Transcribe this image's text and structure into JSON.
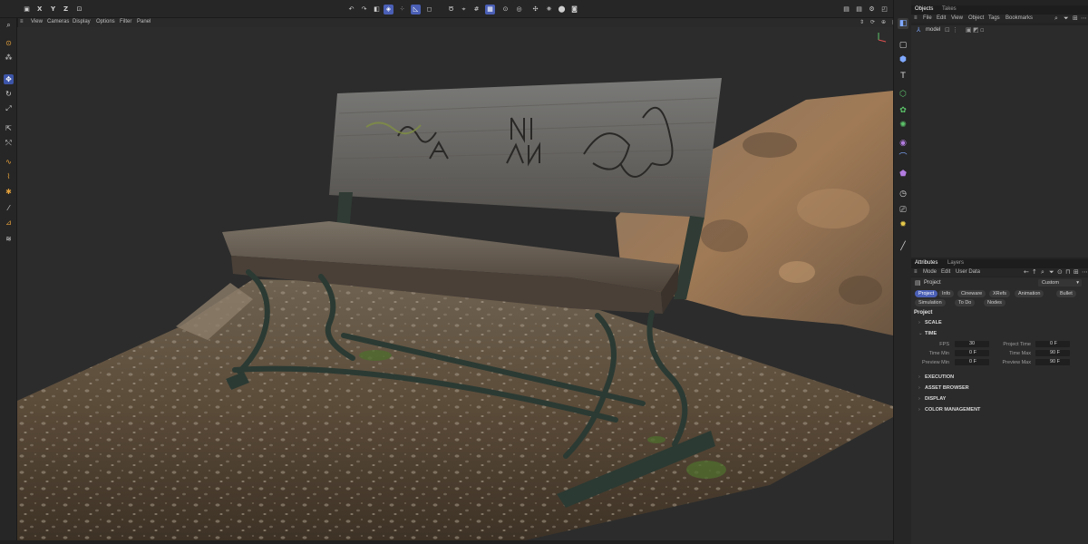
{
  "top_toolbar": {
    "axes": [
      "X",
      "Y",
      "Z"
    ]
  },
  "viewport_menu": [
    "View",
    "Cameras",
    "Display",
    "Options",
    "Filter",
    "Panel"
  ],
  "objects_panel": {
    "tabs": [
      "Objects",
      "Takes"
    ],
    "menu": [
      "File",
      "Edit",
      "View",
      "Object",
      "Tags",
      "Bookmarks"
    ],
    "object_name": "model"
  },
  "attributes_panel": {
    "tabs": [
      "Attributes",
      "Layers"
    ],
    "menu": [
      "Mode",
      "Edit",
      "User Data"
    ],
    "header_title": "Project",
    "dropdown_value": "Custom",
    "pill_tabs_row1": [
      "Project",
      "Info",
      "Cineware",
      "XRefs",
      "Animation",
      "Bullet"
    ],
    "pill_tabs_row2": [
      "Simulation",
      "To Do",
      "Nodes"
    ],
    "section_title": "Project",
    "sections": {
      "scale": "SCALE",
      "time": "TIME",
      "execution": "EXECUTION",
      "asset_browser": "ASSET BROWSER",
      "display": "DISPLAY",
      "color_management": "COLOR MANAGEMENT"
    },
    "time_fields": {
      "fps_label": "FPS",
      "fps_value": "30",
      "project_time_label": "Project Time",
      "project_time_value": "0 F",
      "time_min_label": "Time Min",
      "time_min_value": "0 F",
      "time_max_label": "Time Max",
      "time_max_value": "90 F",
      "preview_min_label": "Preview Min",
      "preview_min_value": "0 F",
      "preview_max_label": "Preview Max",
      "preview_max_value": "90 F"
    }
  },
  "colors": {
    "accent": "#4a5fb5",
    "panel_bg": "#2b2b2b",
    "viewport_bg": "#2c2c2c"
  }
}
